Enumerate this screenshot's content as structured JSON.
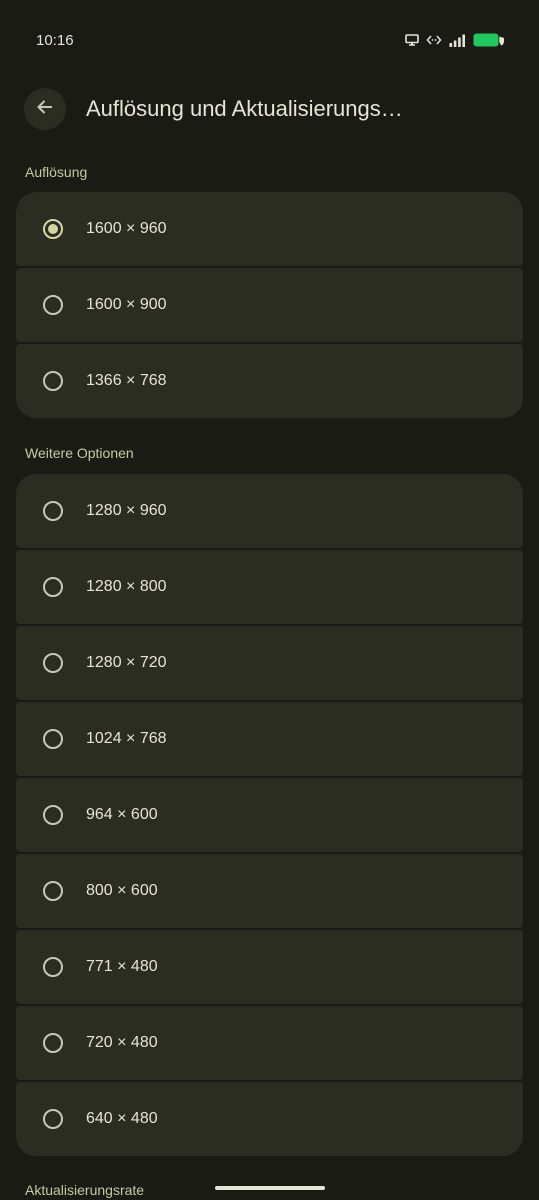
{
  "status_bar": {
    "time": "10:16",
    "icons": [
      "cast-screen-icon",
      "code-brackets-icon",
      "signal-icon",
      "battery-icon"
    ],
    "battery_color": "#22c55e"
  },
  "header": {
    "back_icon": "arrow-left-icon",
    "title": "Auflösung und Aktualisierungs…"
  },
  "resolution": {
    "heading": "Auflösung",
    "options": [
      {
        "label": "1600 × 960",
        "selected": true
      },
      {
        "label": "1600 × 900",
        "selected": false
      },
      {
        "label": "1366 × 768",
        "selected": false
      }
    ]
  },
  "more_options": {
    "heading": "Weitere Optionen",
    "options": [
      {
        "label": "1280 × 960",
        "selected": false
      },
      {
        "label": "1280 × 800",
        "selected": false
      },
      {
        "label": "1280 × 720",
        "selected": false
      },
      {
        "label": "1024 × 768",
        "selected": false
      },
      {
        "label": "964 × 600",
        "selected": false
      },
      {
        "label": "800 × 600",
        "selected": false
      },
      {
        "label": "771 × 480",
        "selected": false
      },
      {
        "label": "720 × 480",
        "selected": false
      },
      {
        "label": "640 × 480",
        "selected": false
      }
    ]
  },
  "refresh_rate": {
    "heading": "Aktualisierungsrate"
  },
  "colors": {
    "background": "#1a1b14",
    "card": "#2b2d22",
    "accent": "#d4d6a6",
    "section_header": "#c5caa4"
  }
}
